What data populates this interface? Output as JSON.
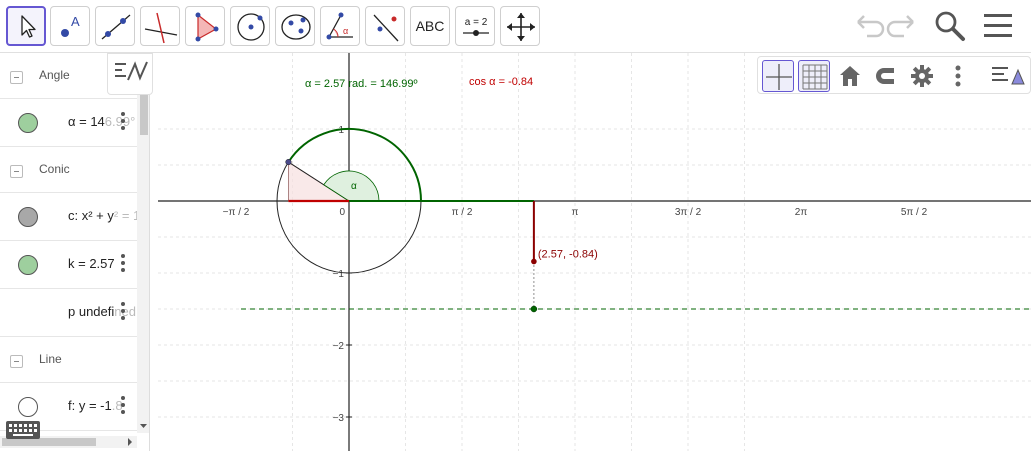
{
  "toolbar": {
    "tools": [
      {
        "name": "move-tool",
        "selected": true
      },
      {
        "name": "point-tool"
      },
      {
        "name": "line-tool"
      },
      {
        "name": "perpendicular-line-tool"
      },
      {
        "name": "polygon-tool"
      },
      {
        "name": "circle-center-point-tool"
      },
      {
        "name": "conic-five-points-tool"
      },
      {
        "name": "angle-tool"
      },
      {
        "name": "reflect-about-line-tool"
      },
      {
        "name": "text-tool",
        "label": "ABC"
      },
      {
        "name": "slider-tool",
        "label": "a = 2"
      },
      {
        "name": "move-graphics-view-tool"
      }
    ],
    "right_icons": [
      "undo-icon",
      "redo-icon",
      "search-icon",
      "menu-icon"
    ]
  },
  "algebra": {
    "groups": [
      {
        "title": "Angle",
        "rows": [
          {
            "main": "α = 14",
            "faded": "6.99°",
            "marker_color": "#9ecf9e"
          }
        ]
      },
      {
        "title": "Conic",
        "rows": [
          {
            "main": "c: x² + y",
            "faded": "² = 1",
            "marker_color": "#a8a8a8"
          },
          {
            "main": "k = 2.57",
            "faded": "",
            "marker_color": "#9ecf9e"
          },
          {
            "main": "p undefi",
            "faded": "ned",
            "marker_color": ""
          }
        ]
      },
      {
        "title": "Line",
        "rows": [
          {
            "main": "f: y = -1",
            "faded": ".8",
            "marker_color": "#ffffff"
          }
        ]
      }
    ]
  },
  "graphics": {
    "labels": {
      "angle_text": "α = 2.57 rad. = 146.99º",
      "cos_text": "cos α = -0.84",
      "point_label": "(2.57, -0.84)",
      "alpha_label": "α"
    },
    "x_ticks": [
      "−π / 2",
      "0",
      "π / 2",
      "π",
      "3π / 2",
      "2π",
      "5π / 2"
    ],
    "y_ticks": [
      "1",
      "−1",
      "−2",
      "−3"
    ],
    "colors": {
      "green": "#006400",
      "red": "#c00000",
      "grid": "#e6e6e6",
      "axis": "#222222",
      "accent": "#6557d2"
    },
    "angle_rad": 2.57,
    "cos_value": -0.84,
    "dashed_line_y": -1.5
  },
  "graphics_stylebar": {
    "icons": [
      "axes-toggle-icon",
      "grid-toggle-icon",
      "home-icon",
      "magnet-icon",
      "gear-icon",
      "more-vertical-icon",
      "style-bar-icon"
    ]
  }
}
